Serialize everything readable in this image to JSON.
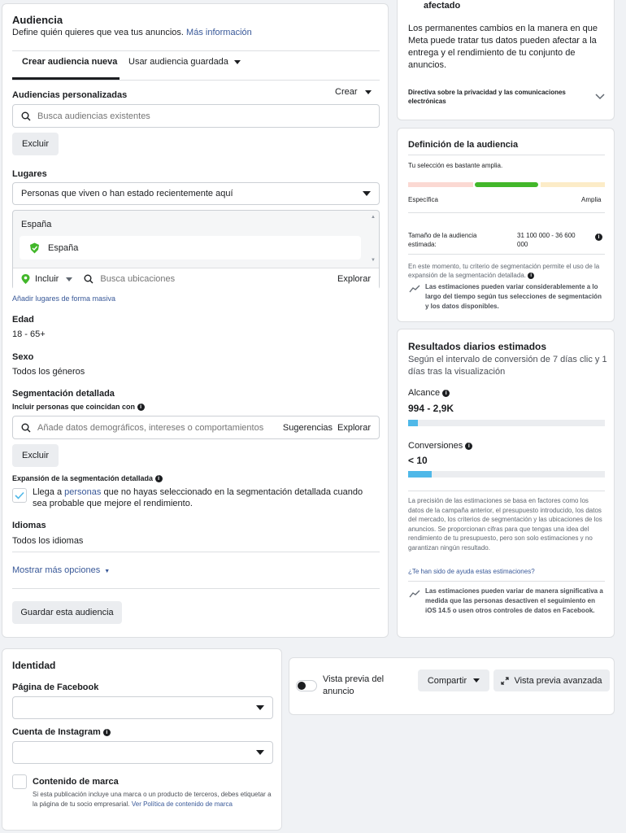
{
  "audience": {
    "title": "Audiencia",
    "subtitle": "Define quién quieres que vea tus anuncios.",
    "more_info": "Más información",
    "tab_new": "Crear audiencia nueva",
    "tab_saved": "Usar audiencia guardada",
    "custom_label": "Audiencias personalizadas",
    "create": "Crear",
    "search_placeholder": "Busca audiencias existentes",
    "exclude": "Excluir",
    "places_label": "Lugares",
    "places_select": "Personas que viven o han estado recientemente aquí",
    "country_header": "España",
    "country_item": "España",
    "include": "Incluir",
    "search_locations": "Busca ubicaciones",
    "explore": "Explorar",
    "bulk_locations": "Añadir lugares de forma masiva",
    "age_label": "Edad",
    "age_value": "18 - 65+",
    "sex_label": "Sexo",
    "sex_value": "Todos los géneros",
    "detailed_label": "Segmentación detallada",
    "detailed_sub": "Incluir personas que coincidan con",
    "detailed_placeholder": "Añade datos demográficos, intereses o comportamientos",
    "suggestions": "Sugerencias",
    "explore2": "Explorar",
    "exclude2": "Excluir",
    "expansion_label": "Expansión de la segmentación detallada",
    "expansion_text_a": "Llega a ",
    "expansion_link": "personas",
    "expansion_text_b": " que no hayas seleccionado en la segmentación detallada cuando sea probable que mejore el rendimiento.",
    "languages_label": "Idiomas",
    "languages_value": "Todos los idiomas",
    "show_more": "Mostrar más opciones",
    "save": "Guardar esta audiencia"
  },
  "privacy": {
    "title_tail": "afectado",
    "body": "Los permanentes cambios en la manera en que Meta puede tratar tus datos pueden afectar a la entrega y el rendimiento de tu conjunto de anuncios.",
    "directive": "Directiva sobre la privacidad y las comunicaciones electrónicas"
  },
  "definition": {
    "title": "Definición de la audiencia",
    "breadth": "Tu selección es bastante amplia.",
    "specific": "Específica",
    "broad": "Amplia",
    "size_label": "Tamaño de la audiencia estimada:",
    "size_value": "31 100 000 - 36 600 000",
    "note": "En este momento, tu criterio de segmentación permite el uso de la expansión de la segmentación detallada.",
    "estimate_note": "Las estimaciones pueden variar considerablemente a lo largo del tiempo según tus selecciones de segmentación y los datos disponibles."
  },
  "results": {
    "title": "Resultados diarios estimados",
    "subtitle": "Según el intervalo de conversión de 7 días clic y 1 días tras la visualización",
    "reach_label": "Alcance",
    "reach_value": "994 - 2,9K",
    "reach_fill": 0.05,
    "conv_label": "Conversiones",
    "conv_value": "< 10",
    "conv_fill": 0.12,
    "precision": "La precisión de las estimaciones se basa en factores como los datos de la campaña anterior, el presupuesto introducido, los datos del mercado, los criterios de segmentación y las ubicaciones de los anuncios. Se proporcionan cifras para que tengas una idea del rendimiento de tu presupuesto, pero son solo estimaciones y no garantizan ningún resultado.",
    "helpful": "¿Te han sido de ayuda estas estimaciones?",
    "ios_note": "Las estimaciones pueden variar de manera significativa a medida que las personas desactiven el seguimiento en iOS 14.5 o usen otros controles de datos en Facebook."
  },
  "identity": {
    "title": "Identidad",
    "facebook_page": "Página de Facebook",
    "instagram": "Cuenta de Instagram",
    "brand_label": "Contenido de marca",
    "brand_text": "Si esta publicación incluye una marca o un producto de terceros, debes etiquetar a la página de tu socio empresarial.",
    "brand_link": "Ver Política de contenido de marca"
  },
  "preview": {
    "label": "Vista previa del anuncio",
    "share": "Compartir",
    "advanced": "Vista previa avanzada"
  },
  "colors": {
    "brand_blue": "#385898",
    "green": "#42b72a",
    "bar_blue": "#4fb8e8"
  }
}
